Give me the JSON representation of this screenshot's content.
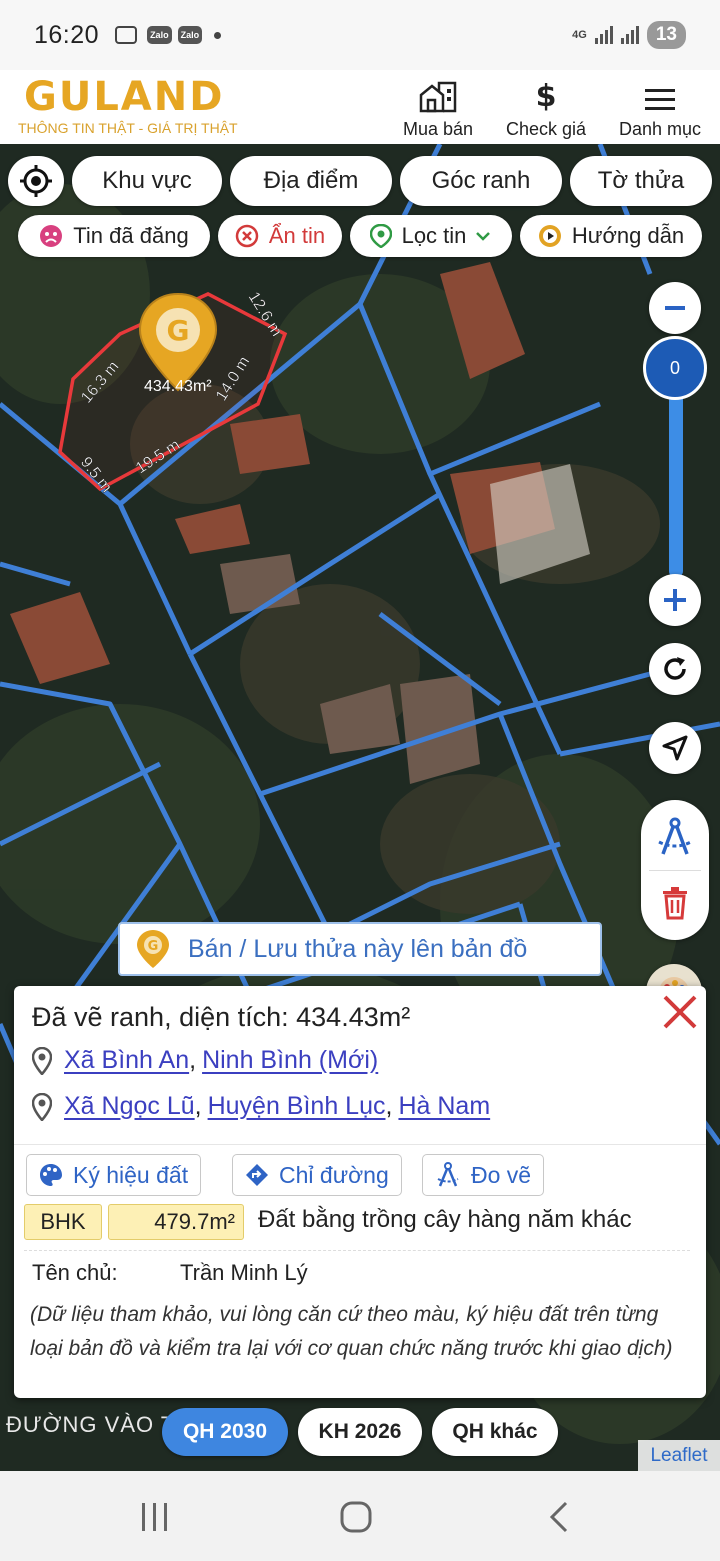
{
  "status_bar": {
    "time": "16:20",
    "zalo_label": "Zalo",
    "network": "4G",
    "battery": "13"
  },
  "header": {
    "logo_text": "GULAND",
    "logo_tagline": "THÔNG TIN THẬT - GIÁ TRỊ THẬT",
    "nav": [
      {
        "label": "Mua bán",
        "icon": "building-icon"
      },
      {
        "label": "Check giá",
        "icon": "dollar-icon"
      },
      {
        "label": "Danh mục",
        "icon": "menu-icon"
      }
    ]
  },
  "filters": {
    "row1": [
      "Khu vực",
      "Địa điểm",
      "Góc ranh",
      "Tờ thửa"
    ],
    "posted": "Tin đã đăng",
    "hide": "Ẩn tin",
    "filter": "Lọc tin",
    "guide": "Hướng dẫn"
  },
  "map": {
    "zoom_value": "0",
    "plot_area_label": "434.43m²",
    "edge_labels": [
      "16.3 m",
      "12.6 m",
      "14.0 m",
      "19.5 m",
      "9.5 m"
    ],
    "save_plot": "Bán / Lưu thửa này lên bản đồ",
    "road_label": "ĐƯỜNG VÀO T",
    "attribution": "Leaflet"
  },
  "panel": {
    "title": "Đã vẽ ranh, diện tích: 434.43m²",
    "address1": {
      "commune": "Xã Bình An",
      "province": "Ninh Bình (Mới)"
    },
    "address2": {
      "commune": "Xã Ngọc Lũ",
      "district": "Huyện Bình Lục",
      "province": "Hà Nam"
    },
    "buttons": {
      "land_symbol": "Ký hiệu đất",
      "directions": "Chỉ đường",
      "measure": "Đo vẽ"
    },
    "land_code": "BHK",
    "land_area": "479.7m²",
    "land_desc": "Đất bằng trồng cây hàng năm khác",
    "owner_label": "Tên chủ:",
    "owner_name": "Trần Minh Lý",
    "disclaimer": "(Dữ liệu tham khảo, vui lòng căn cứ theo màu, ký hiệu đất trên từng loại bản đồ và kiểm tra lại với cơ quan chức năng trước khi giao dịch)"
  },
  "layers": {
    "qh2030": "QH 2030",
    "kh2026": "KH 2026",
    "qh_other": "QH khác"
  },
  "colors": {
    "brand_gold": "#e6a623",
    "parcel_line": "#3f7fd6",
    "plot_outline": "#e8393b",
    "active_layer": "#3e86e0",
    "link": "#3b3fc0"
  }
}
